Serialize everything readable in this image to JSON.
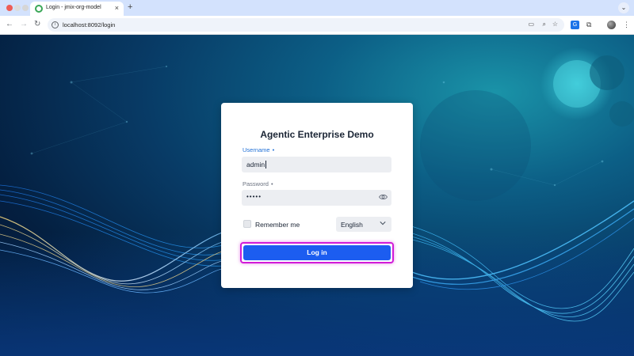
{
  "browser": {
    "tab_title": "Login - jmix-org-model",
    "tab_close": "×",
    "new_tab": "+",
    "url": "localhost:8092/login",
    "icons": [
      "back-icon",
      "forward-icon",
      "reload-icon",
      "site-info-icon",
      "cast-icon",
      "zoom-icon",
      "bookmark-star-icon",
      "translate-icon",
      "extensions-icon",
      "profile-avatar",
      "more-menu-icon"
    ]
  },
  "login": {
    "title": "Agentic Enterprise Demo",
    "username_label": "Username",
    "username_value": "admin",
    "password_label": "Password",
    "password_value": "•••••",
    "required_mark": "•",
    "remember_label": "Remember me",
    "remember_checked": false,
    "language": "English",
    "submit_label": "Log in"
  },
  "colors": {
    "accent": "#1c5df0",
    "focus_outline": "#d11bd8",
    "label_active": "#1f6fd6"
  }
}
